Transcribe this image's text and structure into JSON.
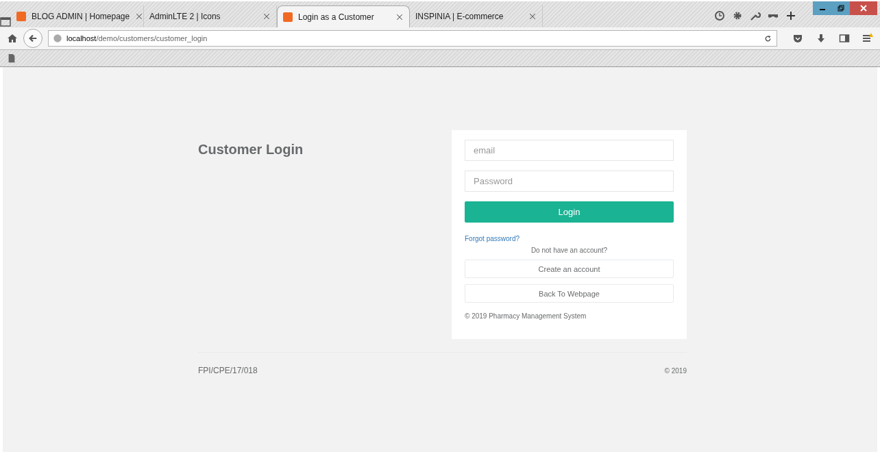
{
  "browser": {
    "tabs": [
      {
        "title": "BLOG ADMIN | Homepage",
        "favicon": true,
        "selected": false
      },
      {
        "title": "AdminLTE 2 | Icons",
        "favicon": false,
        "selected": false
      },
      {
        "title": "Login as a Customer",
        "favicon": true,
        "selected": true
      },
      {
        "title": "INSPINIA | E-commerce",
        "favicon": false,
        "selected": false
      }
    ],
    "address": {
      "host": "localhost",
      "path": "/demo/customers/customer_login"
    }
  },
  "page": {
    "heading": "Customer Login",
    "form": {
      "email": {
        "placeholder": "email"
      },
      "password": {
        "placeholder": "Password"
      },
      "login_button": "Login",
      "forgot_link": "Forgot password?",
      "no_account_text": "Do not have an account?",
      "create_button": "Create an account",
      "back_button": "Back To Webpage",
      "copyright": "© 2019 Pharmacy Management System"
    },
    "footer": {
      "left": "FPI/CPE/17/018",
      "right": "© 2019"
    }
  }
}
